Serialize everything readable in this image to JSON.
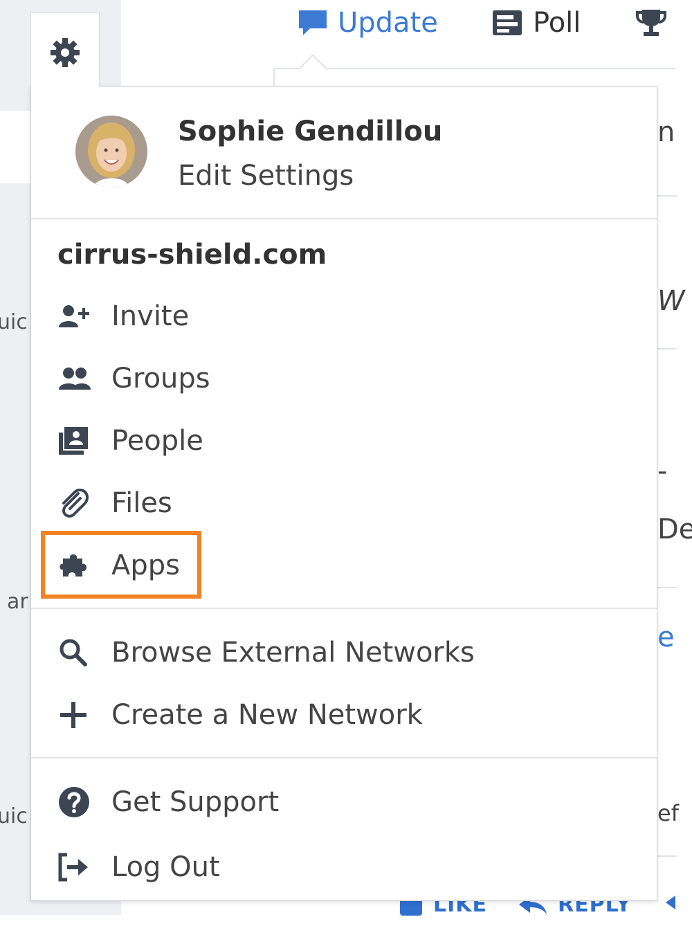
{
  "toolbar": {
    "update_label": "Update",
    "poll_label": "Poll"
  },
  "background": {
    "rail_snippets": [
      "uic",
      "ar",
      "uic"
    ],
    "right_peeks": [
      "n",
      "W",
      "-",
      "De",
      "e",
      "ef"
    ],
    "bottom_like": "LIKE",
    "bottom_reply": "REPLY"
  },
  "menu": {
    "profile": {
      "name": "Sophie Gendillou",
      "settings_link": "Edit Settings"
    },
    "network_name": "cirrus-shield.com",
    "network_items": [
      {
        "label": "Invite",
        "icon": "add-user-icon"
      },
      {
        "label": "Groups",
        "icon": "groups-icon"
      },
      {
        "label": "People",
        "icon": "people-directory-icon"
      },
      {
        "label": "Files",
        "icon": "paperclip-icon"
      },
      {
        "label": "Apps",
        "icon": "puzzle-icon",
        "highlighted": true
      }
    ],
    "external_items": [
      {
        "label": "Browse External Networks",
        "icon": "search-icon"
      },
      {
        "label": "Create a New Network",
        "icon": "plus-icon"
      }
    ],
    "account_items": [
      {
        "label": "Get Support",
        "icon": "help-icon"
      },
      {
        "label": "Log Out",
        "icon": "logout-icon"
      }
    ]
  },
  "colors": {
    "highlight": "#f28224",
    "accent": "#3b7bd4",
    "icon": "#3d4553"
  }
}
